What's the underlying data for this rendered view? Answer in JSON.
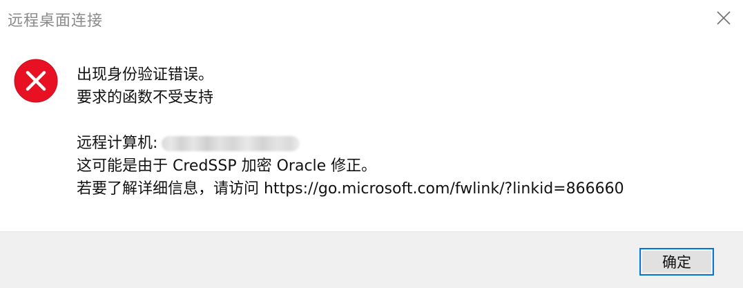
{
  "window": {
    "title": "远程桌面连接",
    "close_icon": "close-icon"
  },
  "message": {
    "icon": "error-icon",
    "lines": [
      "出现身份验证错误。",
      "要求的函数不受支持"
    ],
    "remote_label": "远程计算机:",
    "detail_lines": [
      "这可能是由于 CredSSP 加密 Oracle 修正。",
      "若要了解详细信息，请访问 https://go.microsoft.com/fwlink/?linkid=866660"
    ]
  },
  "footer": {
    "ok_label": "确定"
  },
  "colors": {
    "error_red": "#e81123",
    "accent": "#0078d7",
    "footer_bg": "#f0f0f0"
  }
}
